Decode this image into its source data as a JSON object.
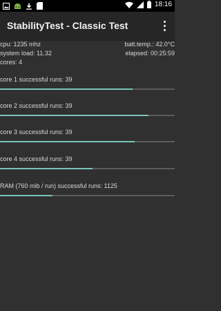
{
  "status_bar": {
    "time": "18:16"
  },
  "app_bar": {
    "title": "StabilityTest - Classic Test"
  },
  "stats": {
    "cpu": "cpu: 1235 mhz",
    "batt_temp": "batt.temp.: 42.0°C",
    "system_load": "system load: 11.32",
    "elapsed": "elapsed: 00:25:59",
    "cores": "cores: 4"
  },
  "tests": [
    {
      "label": "core 1 successful runs: 39",
      "progress": 0.76
    },
    {
      "label": "core 2 successful runs: 39",
      "progress": 0.85
    },
    {
      "label": "core 3 successful runs: 39",
      "progress": 0.77
    },
    {
      "label": "core 4 successful runs: 39",
      "progress": 0.53
    },
    {
      "label": "RAM (760 mib / run) successful runs: 1125",
      "progress": 0.3
    }
  ],
  "colors": {
    "background": "#303030",
    "accent": "#79c6b9",
    "track": "#5b5b5b"
  }
}
